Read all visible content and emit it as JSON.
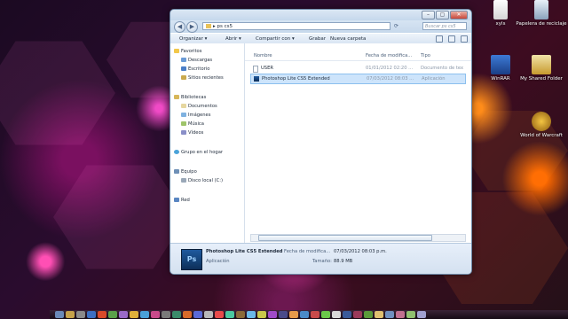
{
  "window": {
    "address": "ps cs5",
    "search_placeholder": "Buscar ps cs5",
    "toolbar": {
      "organize": "Organizar ▾",
      "open": "Abrir ▾",
      "share": "Compartir con ▾",
      "burn": "Grabar",
      "new_folder": "Nueva carpeta"
    }
  },
  "nav": {
    "favorites": "Favoritos",
    "downloads": "Descargas",
    "desktop": "Escritorio",
    "recent": "Sitios recientes",
    "libraries": "Bibliotecas",
    "documents": "Documentos",
    "images": "Imágenes",
    "music": "Música",
    "videos": "Vídeos",
    "homegroup": "Grupo en el hogar",
    "computer": "Equipo",
    "local_disk": "Disco local (C:)",
    "network": "Red"
  },
  "columns": {
    "name": "Nombre",
    "date": "Fecha de modifica...",
    "type": "Tipo"
  },
  "files": [
    {
      "name": "USER",
      "date": "01/01/2012 02:20 ...",
      "type": "Documento de tex"
    },
    {
      "name": "Photoshop Lite CS5 Extended",
      "date": "07/03/2012 08:03 ...",
      "type": "Aplicación"
    }
  ],
  "details": {
    "name": "Photoshop Lite CS5 Extended",
    "type": "Aplicación",
    "date_label": "Fecha de modifica...",
    "date_value": "07/03/2012 08:03 p.m.",
    "size_label": "Tamaño:",
    "size_value": "88.9 MB",
    "icon_text": "Ps"
  },
  "desktop_icons": [
    {
      "label": "xyls"
    },
    {
      "label": "Papelera de reciclaje"
    },
    {
      "label": "WinRAR"
    },
    {
      "label": "My Shared Folder"
    },
    {
      "label": "World of Warcraft"
    }
  ],
  "colors": {
    "selection": "#cde4fb",
    "accent": "#1f5a9e"
  }
}
